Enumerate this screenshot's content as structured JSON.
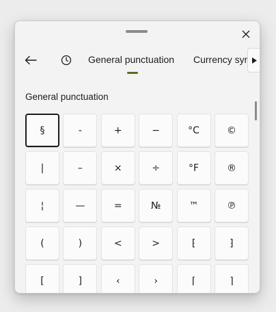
{
  "nav": {
    "tabs": [
      {
        "label": "General punctuation",
        "active": true
      },
      {
        "label": "Currency symbols",
        "active": false
      }
    ]
  },
  "section": {
    "title": "General punctuation"
  },
  "symbols": [
    [
      "§",
      "-",
      "+",
      "−",
      "°C",
      "©"
    ],
    [
      "|",
      "–",
      "×",
      "÷",
      "°F",
      "®"
    ],
    [
      "¦",
      "—",
      "=",
      "№",
      "™",
      "℗"
    ],
    [
      "(",
      ")",
      "<",
      ">",
      "⁅",
      "⁆"
    ],
    [
      "[",
      "]",
      "‹",
      "›",
      "⌈",
      "⌉"
    ]
  ],
  "selected_symbol": "§",
  "colors": {
    "accent": "#5a6b1f",
    "cell_bg": "#fbfbfb"
  },
  "icons": [
    "drag-handle",
    "close-icon",
    "back-arrow-icon",
    "clock-icon",
    "chevron-right-icon"
  ]
}
